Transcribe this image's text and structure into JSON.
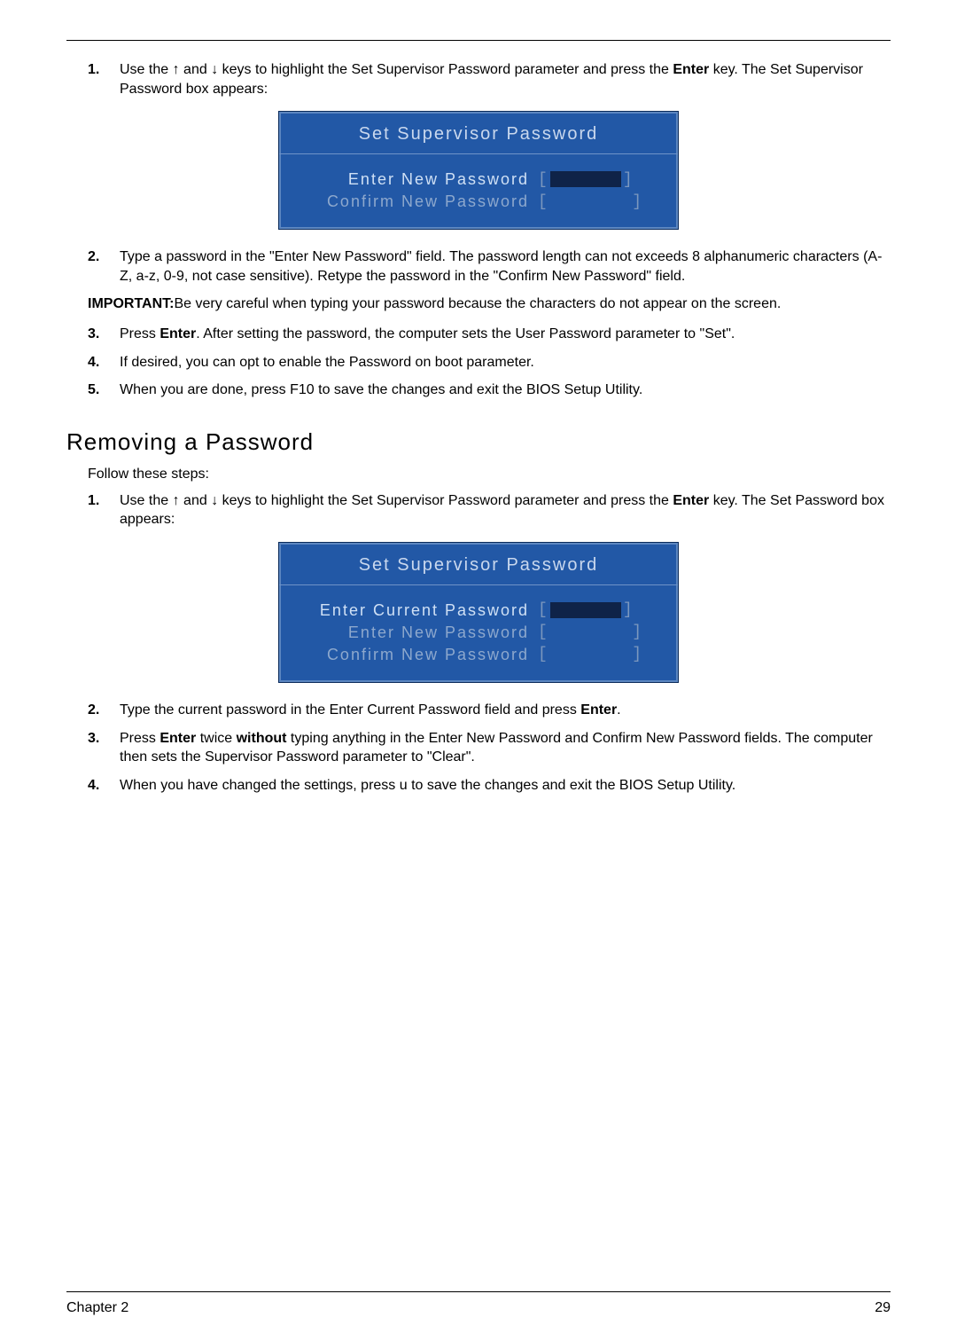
{
  "setSection": {
    "steps": [
      {
        "num": "1.",
        "before": "Use the ",
        "arrow1": "↑",
        "mid": " and ",
        "arrow2": "↓",
        "after": " keys to highlight the Set Supervisor Password parameter and press the ",
        "bold": "Enter",
        "tail": " key. The Set Supervisor Password box appears:"
      }
    ],
    "box": {
      "title": "Set Supervisor Password",
      "rows": [
        {
          "label": "Enter New Password",
          "active": true
        },
        {
          "label": "Confirm New Password",
          "active": false
        }
      ]
    },
    "steps2": [
      {
        "num": "2.",
        "text": "Type a password in the \"Enter New Password\" field. The password length can not exceeds 8 alphanumeric characters (A-Z, a-z, 0-9, not case sensitive). Retype the password in the \"Confirm New Password\" field."
      }
    ],
    "importantLabel": "IMPORTANT:",
    "importantText": "Be very careful when typing your password because the characters do not appear on the screen.",
    "steps3": [
      {
        "num": "3.",
        "before": "Press ",
        "bold": "Enter",
        "after": ". After setting the password, the computer sets the User Password parameter to \"Set\"."
      },
      {
        "num": "4.",
        "text": "If desired, you can opt to enable the Password on boot parameter."
      },
      {
        "num": "5.",
        "text": "When you are done, press F10 to save the changes and exit the BIOS Setup Utility."
      }
    ]
  },
  "removeSection": {
    "heading": "Removing a Password",
    "follow": "Follow these steps:",
    "step1": {
      "num": "1.",
      "before": "Use the ",
      "arrow1": "↑",
      "mid": " and ",
      "arrow2": "↓",
      "after": " keys to highlight the Set Supervisor Password parameter and press the ",
      "bold": "Enter",
      "tail": " key. The Set Password box appears:"
    },
    "box": {
      "title": "Set Supervisor Password",
      "rows": [
        {
          "label": "Enter Current Password",
          "active": true
        },
        {
          "label": "Enter New Password",
          "active": false
        },
        {
          "label": "Confirm New Password",
          "active": false
        }
      ]
    },
    "step2": {
      "num": "2.",
      "before": "Type the current password in the Enter Current Password field and press ",
      "bold": "Enter",
      "after": "."
    },
    "step3": {
      "num": "3.",
      "before": "Press ",
      "bold1": "Enter",
      "mid": " twice ",
      "bold2": "without",
      "after": " typing anything in the Enter New Password and Confirm New Password fields. The computer then sets the Supervisor Password parameter to \"Clear\"."
    },
    "step4": {
      "num": "4.",
      "before": "When you have changed the settings, press ",
      "key": "u",
      "after": " to save the changes and exit the BIOS Setup Utility."
    }
  },
  "footer": {
    "chapter": "Chapter 2",
    "page": "29"
  }
}
